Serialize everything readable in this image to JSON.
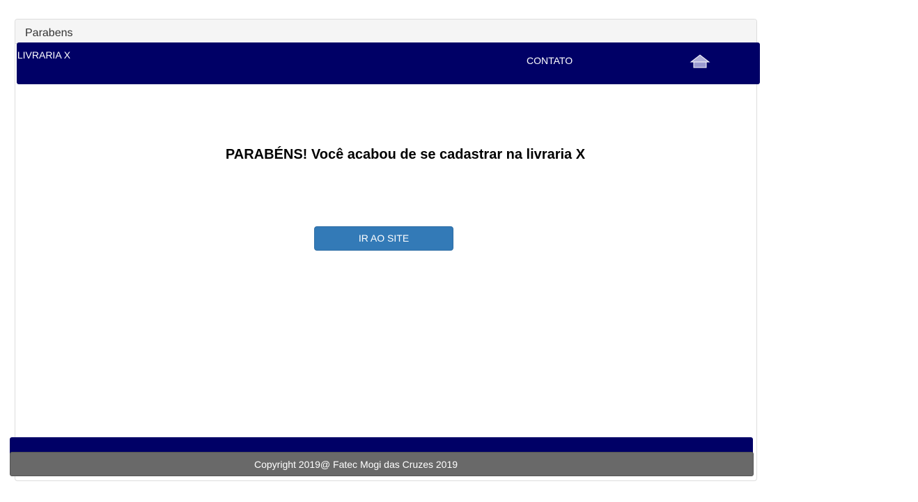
{
  "panel": {
    "title": "Parabens"
  },
  "navbar": {
    "brand": "LIVRARIA X",
    "contato_label": "CONTATO",
    "home_icon": "home-icon"
  },
  "main": {
    "headline": "PARABÉNS! Você acabou de se cadastrar na livraria X",
    "button_label": "IR AO SITE"
  },
  "footer": {
    "copyright": "Copyright 2019@ Fatec Mogi das Cruzes 2019"
  },
  "colors": {
    "navbar_bg": "#000066",
    "button_bg": "#337ab7",
    "footer_bg": "#696969",
    "panel_heading_bg": "#f5f5f5"
  }
}
